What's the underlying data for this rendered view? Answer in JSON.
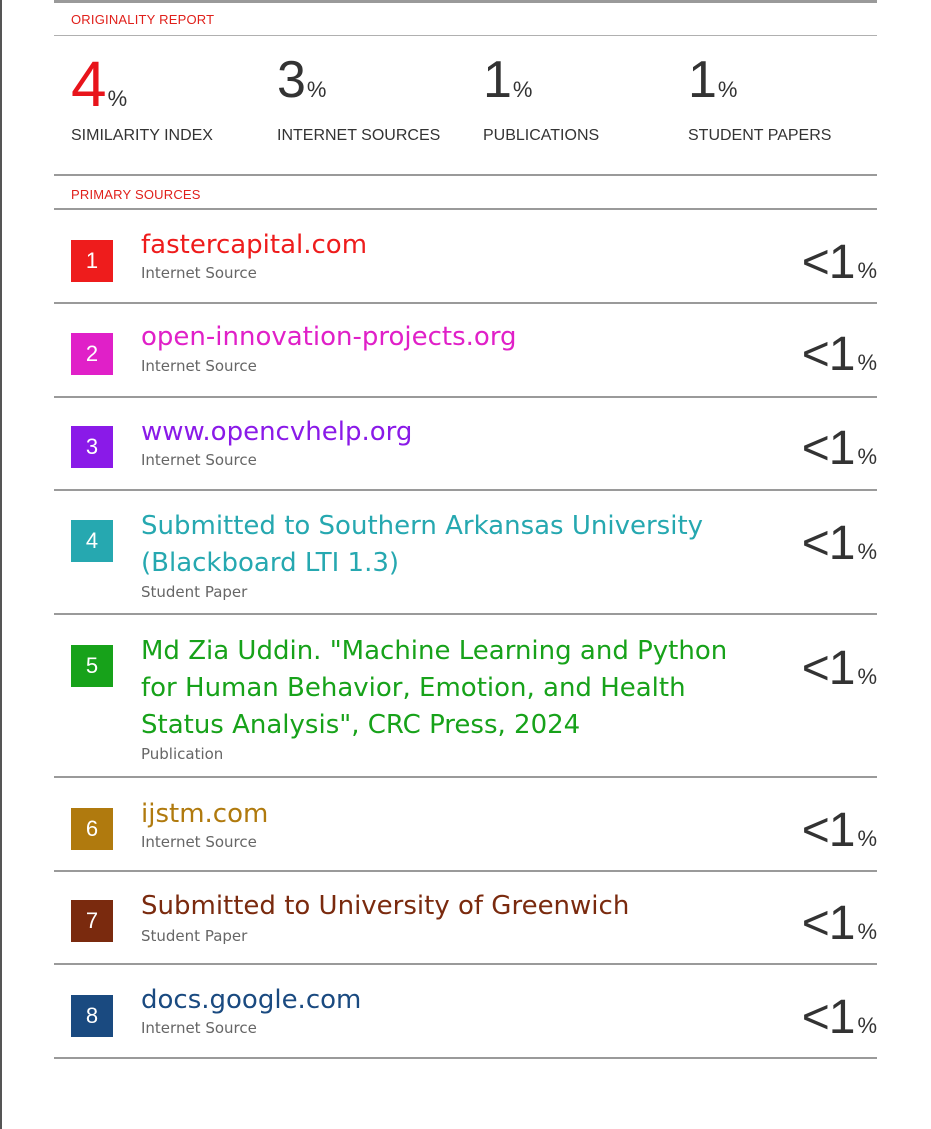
{
  "report": {
    "originality_title": "ORIGINALITY REPORT",
    "primary_sources_title": "PRIMARY SOURCES",
    "stats": [
      {
        "value": "4",
        "unit": "%",
        "label": "SIMILARITY INDEX"
      },
      {
        "value": "3",
        "unit": "%",
        "label": "INTERNET SOURCES"
      },
      {
        "value": "1",
        "unit": "%",
        "label": "PUBLICATIONS"
      },
      {
        "value": "1",
        "unit": "%",
        "label": "STUDENT PAPERS"
      }
    ]
  },
  "sources": [
    {
      "rank": "1",
      "title": "fastercapital.com",
      "type": "Internet Source",
      "pct": "<1",
      "pct_unit": "%",
      "color": "#ee1c1c"
    },
    {
      "rank": "2",
      "title": "open-innovation-projects.org",
      "type": "Internet Source",
      "pct": "<1",
      "pct_unit": "%",
      "color": "#e020c8"
    },
    {
      "rank": "3",
      "title": "www.opencvhelp.org",
      "type": "Internet Source",
      "pct": "<1",
      "pct_unit": "%",
      "color": "#8a1ae8"
    },
    {
      "rank": "4",
      "title": "Submitted to Southern Arkansas University (Blackboard LTI 1.3)",
      "type": "Student Paper",
      "pct": "<1",
      "pct_unit": "%",
      "color": "#26a8b0"
    },
    {
      "rank": "5",
      "title": "Md Zia Uddin. \"Machine Learning and Python for Human Behavior, Emotion, and Health Status Analysis\", CRC Press, 2024",
      "type": "Publication",
      "pct": "<1",
      "pct_unit": "%",
      "color": "#17a21a"
    },
    {
      "rank": "6",
      "title": "ijstm.com",
      "type": "Internet Source",
      "pct": "<1",
      "pct_unit": "%",
      "color": "#b07a0e"
    },
    {
      "rank": "7",
      "title": "Submitted to University of Greenwich",
      "type": "Student Paper",
      "pct": "<1",
      "pct_unit": "%",
      "color": "#7a2a0e"
    },
    {
      "rank": "8",
      "title": "docs.google.com",
      "type": "Internet Source",
      "pct": "<1",
      "pct_unit": "%",
      "color": "#1a4a80"
    }
  ]
}
